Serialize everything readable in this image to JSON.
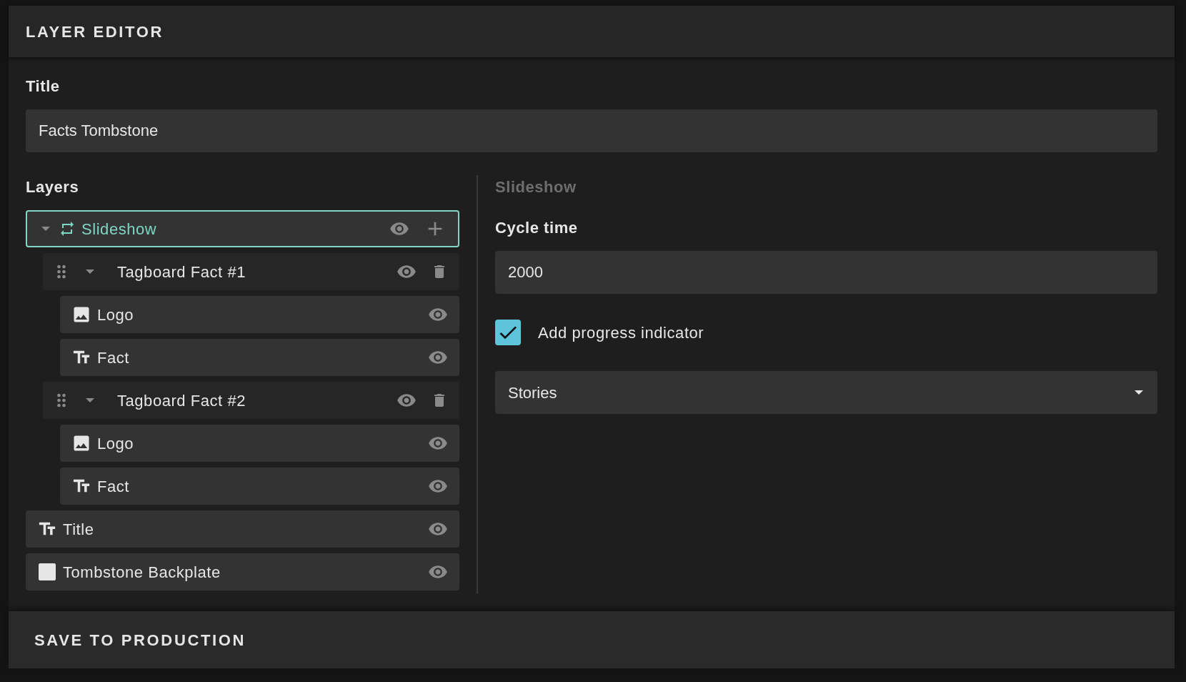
{
  "panel": {
    "title": "LAYER EDITOR"
  },
  "title_field": {
    "label": "Title",
    "value": "Facts Tombstone"
  },
  "layers": {
    "label": "Layers",
    "items": [
      {
        "name": "Slideshow",
        "kind": "slideshow",
        "selected": true,
        "expanded": true,
        "children": [
          {
            "name": "Tagboard Fact #1",
            "kind": "group",
            "selected": false,
            "expanded": true,
            "children": [
              {
                "name": "Logo",
                "kind": "image",
                "selected": false
              },
              {
                "name": "Fact",
                "kind": "text",
                "selected": false
              }
            ]
          },
          {
            "name": "Tagboard Fact #2",
            "kind": "group",
            "selected": false,
            "expanded": true,
            "children": [
              {
                "name": "Logo",
                "kind": "image",
                "selected": false
              },
              {
                "name": "Fact",
                "kind": "text",
                "selected": false
              }
            ]
          }
        ]
      },
      {
        "name": "Title",
        "kind": "text",
        "selected": false
      },
      {
        "name": "Tombstone Backplate",
        "kind": "shape",
        "selected": false
      }
    ]
  },
  "properties": {
    "heading": "Slideshow",
    "cycle_time": {
      "label": "Cycle time",
      "value": "2000"
    },
    "progress": {
      "label": "Add progress indicator",
      "checked": true
    },
    "style_select": {
      "value": "Stories"
    }
  },
  "footer": {
    "button": "SAVE TO PRODUCTION"
  }
}
